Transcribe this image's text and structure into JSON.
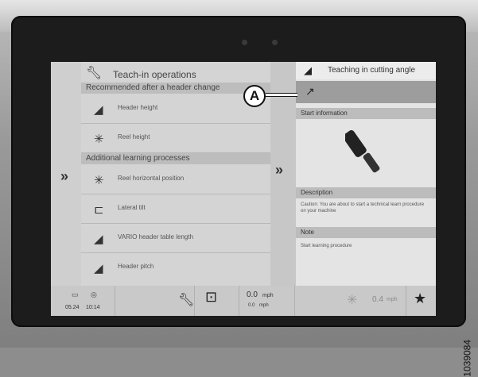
{
  "left_panel": {
    "title": "Teach-in operations",
    "section_recommended": "Recommended after a header change",
    "section_additional": "Additional learning processes",
    "items_recommended": [
      {
        "label": "Header height",
        "icon": "header-height-icon"
      },
      {
        "label": "Reel height",
        "icon": "reel-height-icon"
      }
    ],
    "items_additional": [
      {
        "label": "Reel horizontal position",
        "icon": "reel-horizontal-icon"
      },
      {
        "label": "Lateral tilt",
        "icon": "lateral-tilt-icon"
      },
      {
        "label": "VARIO header table length",
        "icon": "vario-table-icon"
      },
      {
        "label": "Header pitch",
        "icon": "header-pitch-icon"
      }
    ]
  },
  "right_panel": {
    "title": "Teaching in cutting angle",
    "step_arrow": "↗",
    "start_info_label": "Start information",
    "description_label": "Description",
    "description_text": "Caution: You are about to start a technical learn procedure on your machine",
    "note_label": "Note",
    "note_text": "Start learning procedure"
  },
  "bottom_bar": {
    "date": "05.24",
    "time": "10:14",
    "speed_main": "0.0",
    "speed_main_unit": "mph",
    "speed_sub": "0.0",
    "speed_sub_unit": "mph",
    "speed_right": "0.4",
    "speed_right_unit": "mph"
  },
  "callout": {
    "label": "A"
  },
  "figure_number": "1039084"
}
